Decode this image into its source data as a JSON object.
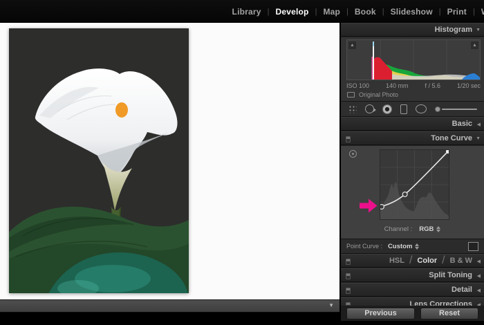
{
  "top_menu": {
    "separator": "|",
    "items": [
      "Library",
      "Develop",
      "Map",
      "Book",
      "Slideshow",
      "Print",
      "We"
    ],
    "active": "Develop"
  },
  "icons": {
    "expanded": "▼",
    "collapsed": "◀",
    "clipping": "▲"
  },
  "histogram": {
    "title": "Histogram",
    "iso": "ISO 100",
    "focal_length": "140 mm",
    "aperture": "f / 5.6",
    "shutter": "1/20 sec",
    "original_photo": "Original Photo"
  },
  "tools": [
    "crop-overlay",
    "spot-removal",
    "red-eye",
    "graduated-filter",
    "radial-filter",
    "adjustment-brush"
  ],
  "panels": {
    "basic": "Basic",
    "tone_curve": "Tone Curve",
    "hsl": "HSL",
    "color": "Color",
    "bw": "B & W",
    "hsl_separator": "/",
    "split_toning": "Split Toning",
    "detail": "Detail",
    "lens_corrections": "Lens Corrections"
  },
  "tone_curve": {
    "channel_label": "Channel :",
    "channel_value": "RGB",
    "point_curve_label": "Point Curve :",
    "point_curve_value": "Custom",
    "curve_points_pct": [
      [
        2,
        18
      ],
      [
        36,
        36
      ],
      [
        99,
        98
      ]
    ]
  },
  "footer_buttons": {
    "previous": "Previous",
    "reset": "Reset"
  },
  "annotation": {
    "color": "#ec108c",
    "shape": "arrow-right"
  }
}
